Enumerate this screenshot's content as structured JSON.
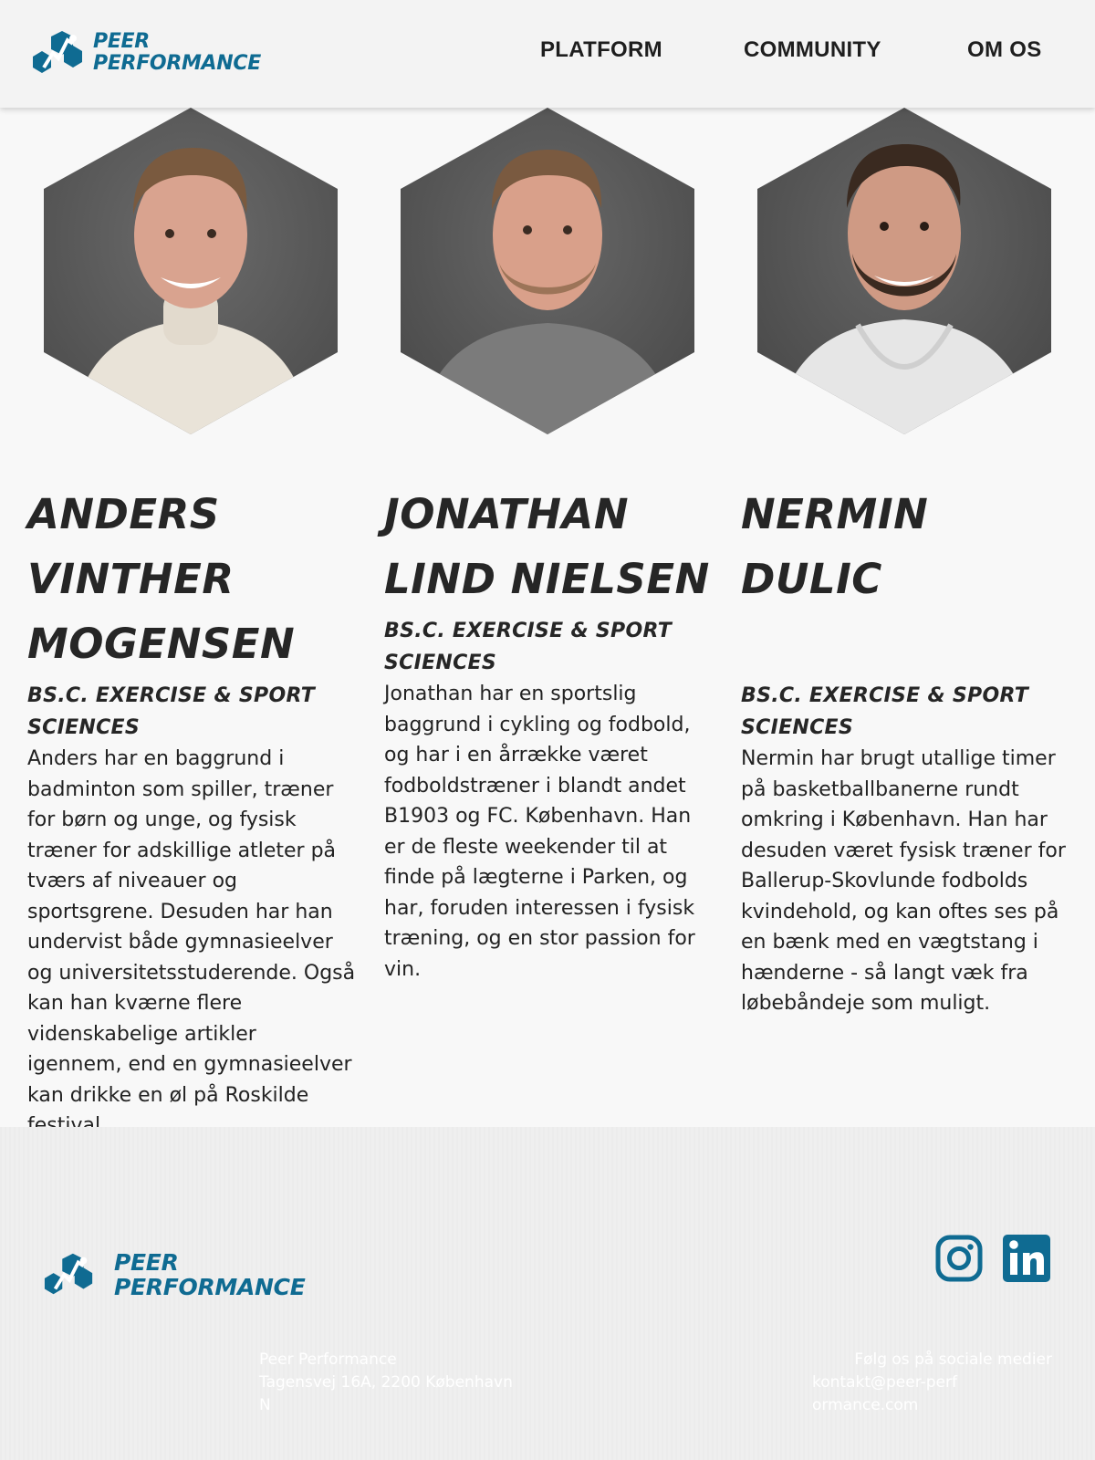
{
  "brand": {
    "line1": "PEER",
    "line2": "PERFORMANCE",
    "color": "#0f6b92"
  },
  "nav": {
    "items": [
      {
        "label": "PLATFORM"
      },
      {
        "label": "COMMUNITY"
      },
      {
        "label": "OM OS"
      }
    ]
  },
  "team": [
    {
      "name": "ANDERS VINTHER MOGENSEN",
      "degree": "BS.C. EXERCISE & SPORT SCIENCES",
      "bio": "Anders har en baggrund i badminton som spiller, træner for børn og unge, og fysisk træner for adskillige atleter på tværs af niveauer og sportsgrene. Desuden har han undervist både gymnasieelver og universitetsstuderende. Også kan han kværne flere videnskabelige artikler igennem, end en gymnasieelver kan drikke en øl på Roskilde festival.",
      "photo": "hexagon-portrait-sweater-cream"
    },
    {
      "name": "JONATHAN LIND NIELSEN",
      "degree": "BS.C. EXERCISE & SPORT SCIENCES",
      "bio": "Jonathan har en sportslig baggrund i cykling og fodbold, og har i en årrække været fodboldstræner i blandt andet B1903 og FC. København. Han er de fleste weekender til at finde på lægterne i Parken, og har, foruden interessen i fysisk træning, og en stor passion for vin.",
      "photo": "hexagon-portrait-sweater-grey"
    },
    {
      "name": "NERMIN DULIC",
      "degree": "BS.C. EXERCISE & SPORT SCIENCES",
      "bio": "Nermin har brugt utallige timer på basketballbanerne rundt omkring i København. Han har desuden været fysisk træner for Ballerup-Skovlunde fodbolds kvindehold, og kan oftes ses på en bænk med en vægtstang i hænderne - så langt væk fra løbebåndeje som muligt.",
      "photo": "hexagon-portrait-tshirt-white"
    }
  ],
  "footer": {
    "company": "Peer Performance",
    "address": "Tagensvej 16A, 2200 København N",
    "social_heading": "Følg os på sociale medier",
    "email": "kontakt@peer-performance.com",
    "social_icons": [
      "instagram-icon",
      "linkedin-icon"
    ]
  }
}
